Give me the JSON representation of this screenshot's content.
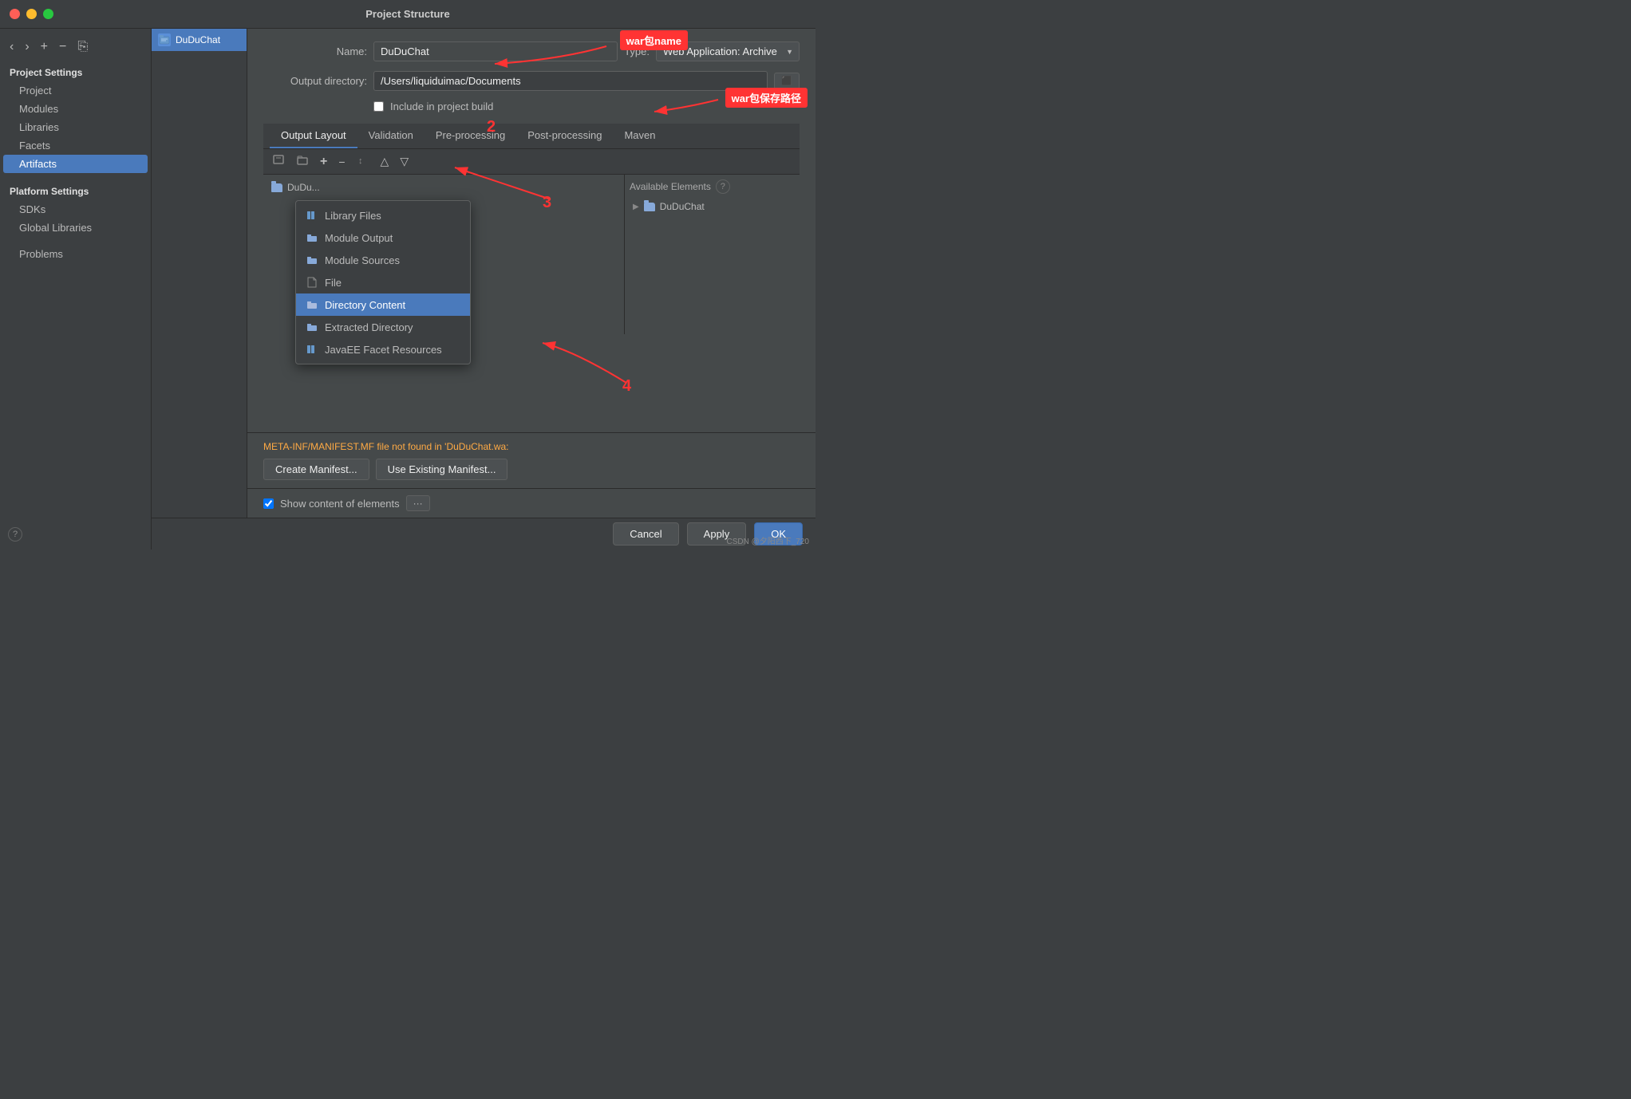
{
  "window": {
    "title": "Project Structure"
  },
  "sidebar": {
    "project_settings_label": "Project Settings",
    "platform_settings_label": "Platform Settings",
    "items": [
      {
        "id": "project",
        "label": "Project"
      },
      {
        "id": "modules",
        "label": "Modules"
      },
      {
        "id": "libraries",
        "label": "Libraries"
      },
      {
        "id": "facets",
        "label": "Facets"
      },
      {
        "id": "artifacts",
        "label": "Artifacts"
      },
      {
        "id": "sdks",
        "label": "SDKs"
      },
      {
        "id": "global-libraries",
        "label": "Global Libraries"
      },
      {
        "id": "problems",
        "label": "Problems"
      }
    ]
  },
  "artifact": {
    "name": "DuDuChat",
    "name_label": "Name:",
    "type_label": "Type:",
    "type_value": "Web Application: Archive",
    "output_dir_label": "Output directory:",
    "output_dir_value": "/Users/liquiduimac/Documents",
    "include_in_build_label": "Include in project build"
  },
  "tabs": [
    {
      "id": "output-layout",
      "label": "Output Layout"
    },
    {
      "id": "validation",
      "label": "Validation"
    },
    {
      "id": "pre-processing",
      "label": "Pre-processing"
    },
    {
      "id": "post-processing",
      "label": "Post-processing"
    },
    {
      "id": "maven",
      "label": "Maven"
    }
  ],
  "toolbar": {
    "add_icon": "+",
    "remove_icon": "−",
    "copy_icon": "⎘",
    "move_down_icon": "↓",
    "move_up_icon": "↑",
    "expand_icon": "▾"
  },
  "available_elements": {
    "label": "Available Elements",
    "help_icon": "?"
  },
  "tree": {
    "item_label": "DuDu..."
  },
  "available_tree": {
    "item_label": "DuDuChat"
  },
  "dropdown_menu": {
    "items": [
      {
        "id": "library-files",
        "label": "Library Files"
      },
      {
        "id": "module-output",
        "label": "Module Output"
      },
      {
        "id": "module-sources",
        "label": "Module Sources"
      },
      {
        "id": "file",
        "label": "File"
      },
      {
        "id": "directory-content",
        "label": "Directory Content",
        "selected": true
      },
      {
        "id": "extracted-directory",
        "label": "Extracted Directory"
      },
      {
        "id": "javaee-facet-resources",
        "label": "JavaEE Facet Resources"
      }
    ]
  },
  "manifest": {
    "warning": "META-INF/MANIFEST.MF file not found in 'DuDuChat.wa:",
    "create_btn": "Create Manifest...",
    "use_existing_btn": "Use Existing Manifest..."
  },
  "show_content": {
    "label": "Show content of elements",
    "checked": true
  },
  "bottom_bar": {
    "cancel_label": "Cancel",
    "apply_label": "Apply",
    "ok_label": "OK"
  },
  "annotations": {
    "war_name": "war包name",
    "war_path": "war包保存路径",
    "num2": "2",
    "num3": "3",
    "num4": "4"
  },
  "watermark": "CSDN @夕阳西下_720"
}
